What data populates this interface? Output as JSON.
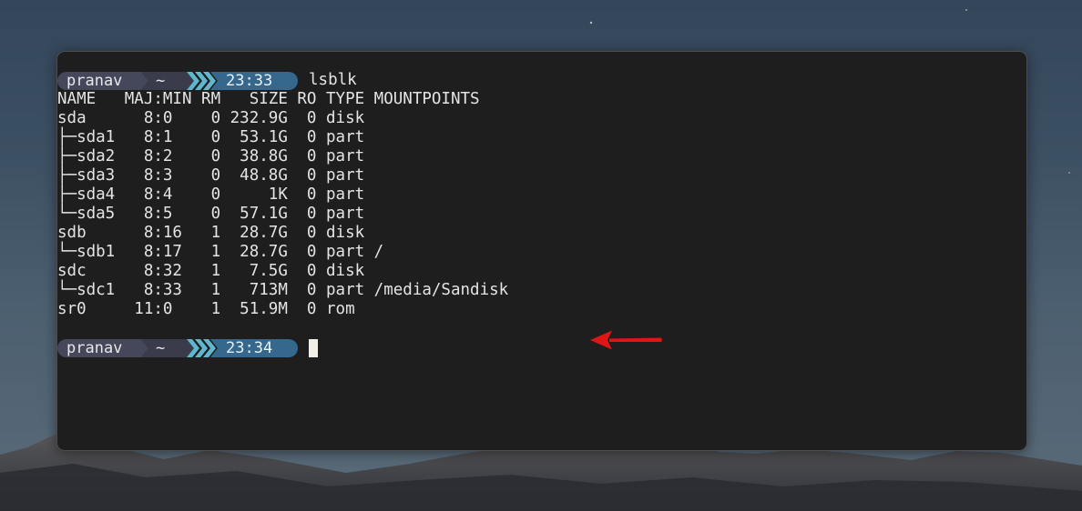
{
  "prompt1": {
    "user": "pranav",
    "dir": "~",
    "time": "23:33",
    "command": "lsblk"
  },
  "output": {
    "lines": [
      "NAME   MAJ:MIN RM   SIZE RO TYPE MOUNTPOINTS",
      "sda      8:0    0 232.9G  0 disk",
      "├─sda1   8:1    0  53.1G  0 part",
      "├─sda2   8:2    0  38.8G  0 part",
      "├─sda3   8:3    0  48.8G  0 part",
      "├─sda4   8:4    0     1K  0 part",
      "└─sda5   8:5    0  57.1G  0 part",
      "sdb      8:16   1  28.7G  0 disk",
      "└─sdb1   8:17   1  28.7G  0 part /",
      "sdc      8:32   1   7.5G  0 disk",
      "└─sdc1   8:33   1   713M  0 part /media/Sandisk",
      "sr0     11:0    1  51.9M  0 rom"
    ]
  },
  "prompt2": {
    "user": "pranav",
    "dir": "~",
    "time": "23:34"
  },
  "colors": {
    "terminal_bg": "#1e1e1e",
    "text": "#e4e4e4",
    "prompt_user_bg": "#45475a",
    "prompt_dir_bg": "#3a3c4c",
    "prompt_git_chevrons": "#5fb7cf",
    "prompt_time_bg": "#36688e",
    "annotation_arrow": "#e01515",
    "cursor": "#f0f0e6"
  },
  "icons": {
    "prompt_separator": "powerline-chevron-icon",
    "annotation": "red-arrow-left-icon"
  }
}
